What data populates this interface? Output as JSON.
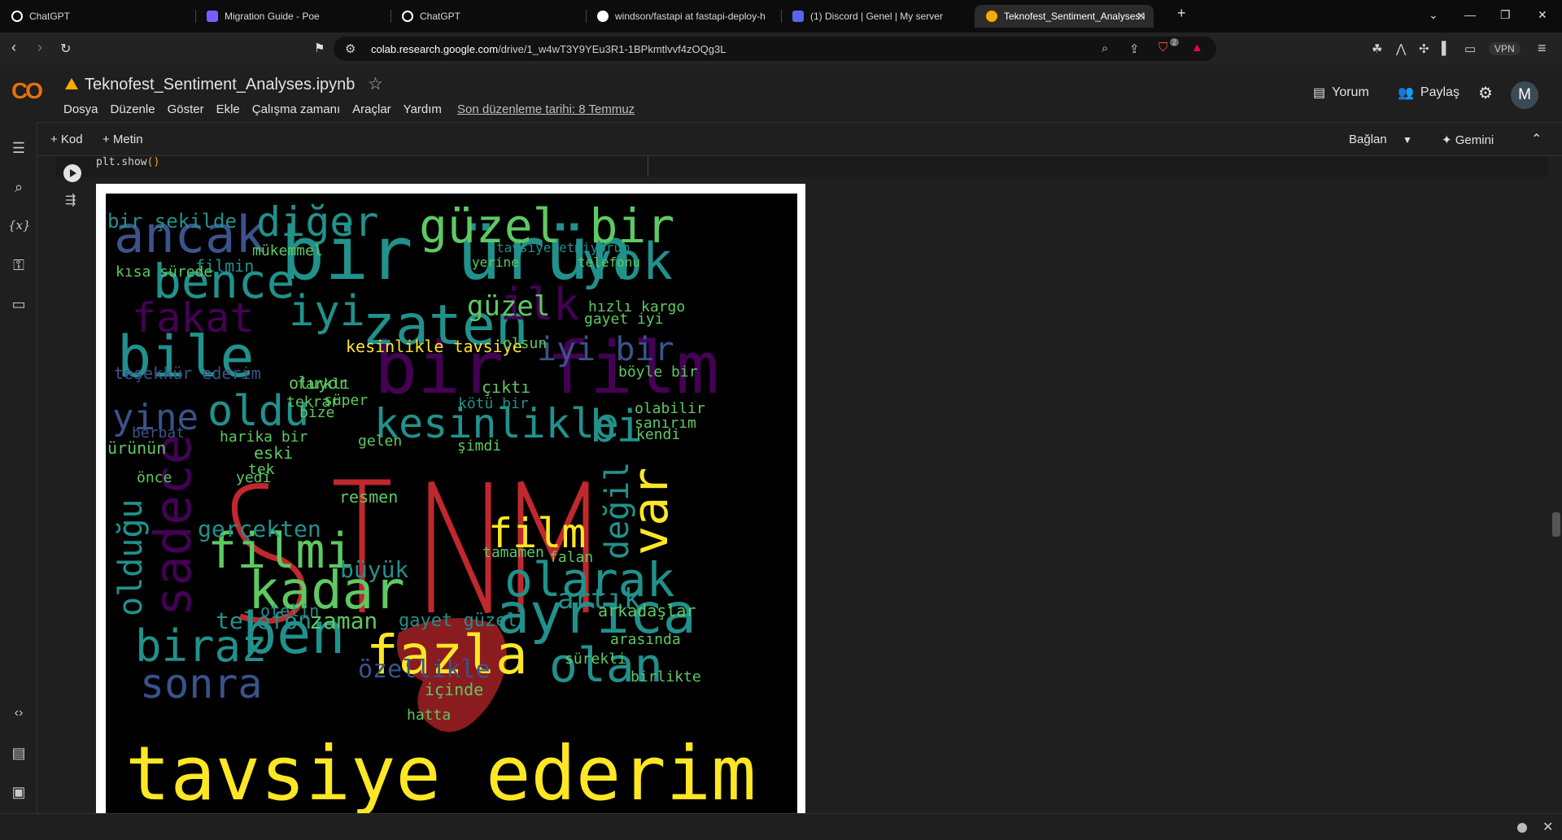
{
  "browser": {
    "tabs": [
      {
        "label": "ChatGPT",
        "color": "#ffffff"
      },
      {
        "label": "Migration Guide - Poe",
        "color": "#7b5cff"
      },
      {
        "label": "ChatGPT",
        "color": "#ffffff"
      },
      {
        "label": "windson/fastapi at fastapi-deploy-h",
        "color": "#ffffff"
      },
      {
        "label": "(1) Discord | Genel | My server",
        "color": "#5865f2"
      },
      {
        "label": "Teknofest_Sentiment_Analyses.i",
        "color": "#f9ab00",
        "active": true
      }
    ],
    "new_tab": "+",
    "url_host": "colab.research.google.com",
    "url_path": "/drive/1_w4wT3Y9YEu3R1-1BPkmtlvvf4zOQg3L",
    "vpn_label": "VPN",
    "shield_badge": "2"
  },
  "colab": {
    "logo": "CO",
    "title": "Teknofest_Sentiment_Analyses.ipynb",
    "menus": [
      "Dosya",
      "Düzenle",
      "Göster",
      "Ekle",
      "Çalışma zamanı",
      "Araçlar",
      "Yardım"
    ],
    "last_edit": "Son düzenleme tarihi: 8 Temmuz",
    "comment_btn": "Yorum",
    "share_btn": "Paylaş",
    "avatar_letter": "M",
    "toolbar": {
      "add_code": "+ Kod",
      "add_text": "+ Metin",
      "connect": "Bağlan",
      "gemini": "✦ Gemini"
    },
    "code_line": "plt.show()",
    "code_fn": "plt.show",
    "code_paren": "()"
  },
  "wordcloud": {
    "colors": {
      "yellow": "#fde725",
      "green": "#5ec962",
      "teal": "#21918c",
      "blue": "#3b528b",
      "purple": "#440154",
      "red": "#c0282d"
    },
    "words": [
      {
        "t": "tavsiye ederim",
        "c": "yellow"
      },
      {
        "t": "bir ürün",
        "c": "teal"
      },
      {
        "t": "bir film",
        "c": "purple"
      },
      {
        "t": "güzel bir",
        "c": "green"
      },
      {
        "t": "bence",
        "c": "teal"
      },
      {
        "t": "ancak",
        "c": "blue"
      },
      {
        "t": "diğer",
        "c": "teal"
      },
      {
        "t": "yok",
        "c": "teal"
      },
      {
        "t": "fakat",
        "c": "purple"
      },
      {
        "t": "iyi",
        "c": "teal"
      },
      {
        "t": "zaten",
        "c": "teal"
      },
      {
        "t": "ilk",
        "c": "purple"
      },
      {
        "t": "bile",
        "c": "teal"
      },
      {
        "t": "iyi bir",
        "c": "blue"
      },
      {
        "t": "yine",
        "c": "blue"
      },
      {
        "t": "oldu",
        "c": "teal"
      },
      {
        "t": "kesinlikle",
        "c": "teal"
      },
      {
        "t": "bi",
        "c": "teal"
      },
      {
        "t": "film",
        "c": "yellow"
      },
      {
        "t": "olarak",
        "c": "teal"
      },
      {
        "t": "filmi",
        "c": "green"
      },
      {
        "t": "kadar",
        "c": "green"
      },
      {
        "t": "ayrıca",
        "c": "teal"
      },
      {
        "t": "ben",
        "c": "teal"
      },
      {
        "t": "biraz",
        "c": "teal"
      },
      {
        "t": "fazla",
        "c": "yellow"
      },
      {
        "t": "olan",
        "c": "teal"
      },
      {
        "t": "sonra",
        "c": "blue"
      },
      {
        "t": "zaman",
        "c": "green"
      },
      {
        "t": "büyük",
        "c": "teal"
      },
      {
        "t": "sadece",
        "c": "purple"
      },
      {
        "t": "olduğu",
        "c": "teal"
      },
      {
        "t": "var",
        "c": "yellow"
      },
      {
        "t": "değil",
        "c": "teal"
      },
      {
        "t": "güzel",
        "c": "green"
      },
      {
        "t": "filmin",
        "c": "teal"
      },
      {
        "t": "gerçekten",
        "c": "teal"
      },
      {
        "t": "kesinlikle tavsiye",
        "c": "yellow"
      },
      {
        "t": "hızlı kargo",
        "c": "green"
      },
      {
        "t": "gayet iyi",
        "c": "green"
      },
      {
        "t": "tavsiye etmiyorum",
        "c": "teal"
      },
      {
        "t": "yerine",
        "c": "green"
      },
      {
        "t": "telefonu",
        "c": "green"
      },
      {
        "t": "bir şekilde",
        "c": "teal"
      },
      {
        "t": "mükemmel",
        "c": "green"
      },
      {
        "t": "olsun",
        "c": "green"
      },
      {
        "t": "oluyor",
        "c": "green"
      },
      {
        "t": "tekrar",
        "c": "green"
      },
      {
        "t": "süper",
        "c": "green"
      },
      {
        "t": "farklı",
        "c": "green"
      },
      {
        "t": "bize",
        "c": "green"
      },
      {
        "t": "harika bir",
        "c": "green"
      },
      {
        "t": "eski",
        "c": "green"
      },
      {
        "t": "gelen",
        "c": "green"
      },
      {
        "t": "şimdi",
        "c": "green"
      },
      {
        "t": "tek",
        "c": "green"
      },
      {
        "t": "resmen",
        "c": "green"
      },
      {
        "t": "telefon",
        "c": "teal"
      },
      {
        "t": "özellikle",
        "c": "blue"
      },
      {
        "t": "gayet güzel",
        "c": "teal"
      },
      {
        "t": "tamamen",
        "c": "green"
      },
      {
        "t": "falan",
        "c": "green"
      },
      {
        "t": "artık",
        "c": "teal"
      },
      {
        "t": "arkadaşlar",
        "c": "green"
      },
      {
        "t": "böyle bir",
        "c": "green"
      },
      {
        "t": "kötü bir",
        "c": "teal"
      },
      {
        "t": "çıktı",
        "c": "green"
      },
      {
        "t": "sürekli",
        "c": "green"
      },
      {
        "t": "arasında",
        "c": "green"
      },
      {
        "t": "birlikte",
        "c": "green"
      },
      {
        "t": "kendi",
        "c": "green"
      },
      {
        "t": "sanırım",
        "c": "green"
      },
      {
        "t": "olabilir",
        "c": "green"
      },
      {
        "t": "ürünün",
        "c": "green"
      },
      {
        "t": "teşekkür ederim",
        "c": "blue"
      },
      {
        "t": "otelin",
        "c": "teal"
      },
      {
        "t": "hatta",
        "c": "green"
      },
      {
        "t": "içinde",
        "c": "green"
      },
      {
        "t": "önce",
        "c": "green"
      },
      {
        "t": "berbat",
        "c": "blue"
      },
      {
        "t": "yedi",
        "c": "green"
      },
      {
        "t": "kısa sürede",
        "c": "green"
      }
    ]
  }
}
